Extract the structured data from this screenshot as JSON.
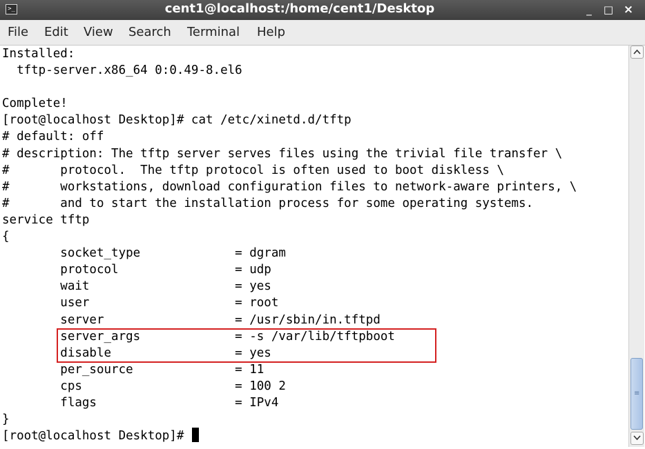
{
  "window": {
    "title": "cent1@localhost:/home/cent1/Desktop",
    "icon": "terminal-icon",
    "controls": {
      "minimize": "_",
      "maximize": "□",
      "close": "×"
    }
  },
  "menu": [
    "File",
    "Edit",
    "View",
    "Search",
    "Terminal",
    "Help"
  ],
  "terminal": {
    "lines": [
      "Installed:",
      "  tftp-server.x86_64 0:0.49-8.el6",
      "",
      "Complete!",
      "[root@localhost Desktop]# cat /etc/xinetd.d/tftp",
      "# default: off",
      "# description: The tftp server serves files using the trivial file transfer \\",
      "#       protocol.  The tftp protocol is often used to boot diskless \\",
      "#       workstations, download configuration files to network-aware printers, \\",
      "#       and to start the installation process for some operating systems.",
      "service tftp",
      "{",
      "        socket_type             = dgram",
      "        protocol                = udp",
      "        wait                    = yes",
      "        user                    = root",
      "        server                  = /usr/sbin/in.tftpd",
      "        server_args             = -s /var/lib/tftpboot",
      "        disable                 = yes",
      "        per_source              = 11",
      "        cps                     = 100 2",
      "        flags                   = IPv4",
      "}",
      "[root@localhost Desktop]# "
    ],
    "highlight_color": "#d42020",
    "highlighted_lines": [
      "server_args",
      "disable"
    ]
  },
  "scrollbar": {
    "position_fraction": 1.0,
    "up_icon": "chevron-up-icon",
    "down_icon": "chevron-down-icon"
  }
}
